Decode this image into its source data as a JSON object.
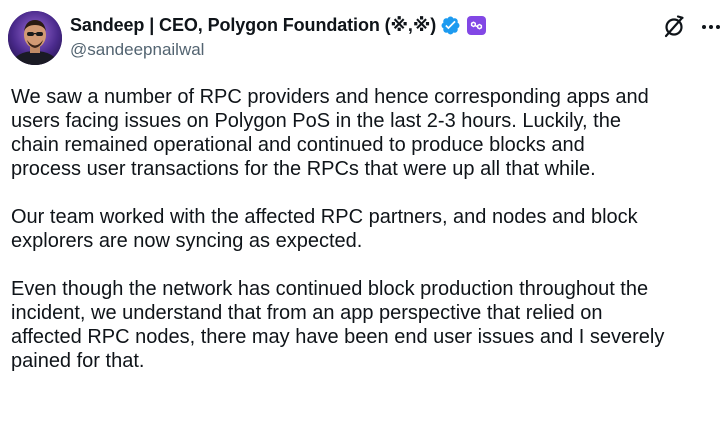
{
  "author": {
    "display_name": "Sandeep | CEO, Polygon Foundation (※,※)",
    "handle": "@sandeepnailwal",
    "verified": true
  },
  "icons": {
    "verified_badge": "verified-check-icon",
    "affiliate_badge": "polygon-logo-icon",
    "grok": "grok-icon",
    "more": "more-options-icon"
  },
  "colors": {
    "verified_blue": "#1d9bf0",
    "polygon_purple": "#8247e5",
    "text_primary": "#0f1419",
    "text_secondary": "#536471"
  },
  "tweet": {
    "paragraphs": [
      "We saw a number of RPC providers and hence corresponding apps and\nusers facing issues on Polygon PoS in the last 2-3 hours. Luckily, the\nchain remained operational and continued to produce blocks and\nprocess user transactions for the RPCs that were up all that while.",
      "Our team worked with the affected RPC partners, and nodes and block\nexplorers are now syncing as expected.",
      "Even though the network has continued block production throughout the\nincident, we understand that from an app perspective that relied on\naffected RPC nodes, there may have been end user issues and I severely\npained for that."
    ]
  }
}
